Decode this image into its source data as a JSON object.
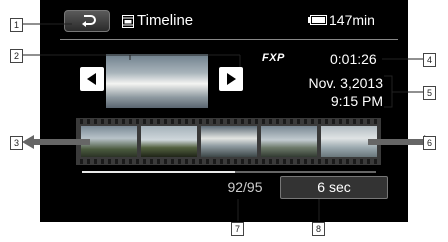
{
  "header": {
    "title": "Timeline",
    "battery_text": "147min"
  },
  "info": {
    "mode": "FXP",
    "timecode": "0:01:26",
    "date": "Nov. 3,2013",
    "time": "9:15 PM"
  },
  "footer": {
    "counter": "92/95",
    "interval_button": "6 sec"
  },
  "progress_fraction": 0.52,
  "callouts": [
    "1",
    "2",
    "3",
    "4",
    "5",
    "6",
    "7",
    "8"
  ],
  "icons": {
    "back": "return-arrow-icon",
    "timeline": "timeline-icon",
    "battery": "battery-icon",
    "prev": "left-triangle-icon",
    "next": "right-triangle-icon"
  }
}
